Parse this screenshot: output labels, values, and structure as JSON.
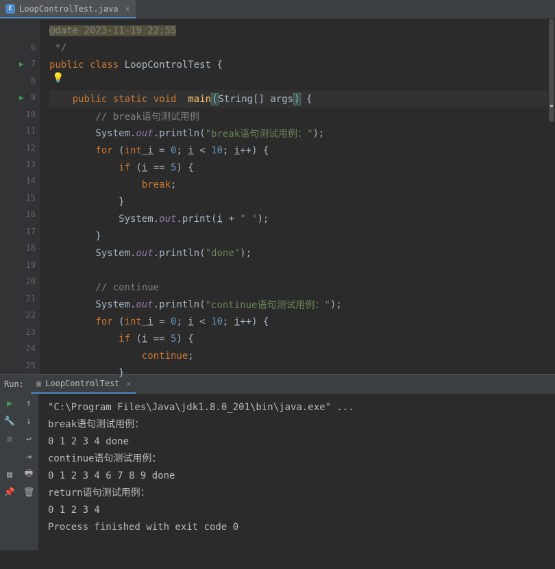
{
  "tab": {
    "label": "LoopControlTest.java"
  },
  "lines": {
    "date": "@date 2023-11-19 22:55",
    "l6": " */",
    "l7_1": "public",
    "l7_2": " class",
    "l7_3": " LoopControlTest {",
    "l9_1": "    public",
    "l9_2": " static",
    "l9_3": " void",
    "l9_4": " main",
    "l9_5": "(",
    "l9_6": "String[] args",
    "l9_7": ")",
    "l9_8": " {",
    "l10": "        // break语句测试用例",
    "l11_1": "        System.",
    "l11_2": "out",
    "l11_3": ".println(",
    "l11_4": "\"break语句测试用例：\"",
    "l11_5": ");",
    "l12_1": "        for",
    "l12_2": " (",
    "l12_3": "int",
    "l12_4": " i",
    "l12_5": " = ",
    "l12_6": "0",
    "l12_7": "; ",
    "l12_8": "i",
    "l12_9": " < ",
    "l12_10": "10",
    "l12_11": "; ",
    "l12_12": "i",
    "l12_13": "++) {",
    "l13_1": "            if",
    "l13_2": " (",
    "l13_3": "i",
    "l13_4": " == ",
    "l13_5": "5",
    "l13_6": ") {",
    "l14_1": "                break",
    "l14_2": ";",
    "l15": "            }",
    "l16_1": "            System.",
    "l16_2": "out",
    "l16_3": ".print(",
    "l16_4": "i",
    "l16_5": " + ",
    "l16_6": "\" \"",
    "l16_7": ");",
    "l17": "        }",
    "l18_1": "        System.",
    "l18_2": "out",
    "l18_3": ".println(",
    "l18_4": "\"done\"",
    "l18_5": ");",
    "l20": "        // continue",
    "l21_1": "        System.",
    "l21_2": "out",
    "l21_3": ".println(",
    "l21_4": "\"continue语句测试用例：\"",
    "l21_5": ");",
    "l22_1": "        for",
    "l22_2": " (",
    "l22_3": "int",
    "l22_4": " i",
    "l22_5": " = ",
    "l22_6": "0",
    "l22_7": "; ",
    "l22_8": "i",
    "l22_9": " < ",
    "l22_10": "10",
    "l22_11": "; ",
    "l22_12": "i",
    "l22_13": "++) {",
    "l23_1": "            if",
    "l23_2": " (",
    "l23_3": "i",
    "l23_4": " == ",
    "l23_5": "5",
    "l23_6": ") {",
    "l24_1": "                continue",
    "l24_2": ";",
    "l25": "            }"
  },
  "gutter": {
    "nums": [
      "",
      "6",
      "7",
      "8",
      "9",
      "10",
      "11",
      "12",
      "13",
      "14",
      "15",
      "16",
      "17",
      "18",
      "19",
      "20",
      "21",
      "22",
      "23",
      "24",
      "25"
    ]
  },
  "run": {
    "label": "Run:",
    "tab": "LoopControlTest",
    "output": {
      "path": "\"C:\\Program Files\\Java\\jdk1.8.0_201\\bin\\java.exe\" ...",
      "l1": "break语句测试用例：",
      "l2": "0 1 2 3 4 done",
      "l3": "continue语句测试用例：",
      "l4": "0 1 2 3 4 6 7 8 9 done",
      "l5": "return语句测试用例：",
      "l6": "0 1 2 3 4 ",
      "l7": "Process finished with exit code 0"
    }
  }
}
